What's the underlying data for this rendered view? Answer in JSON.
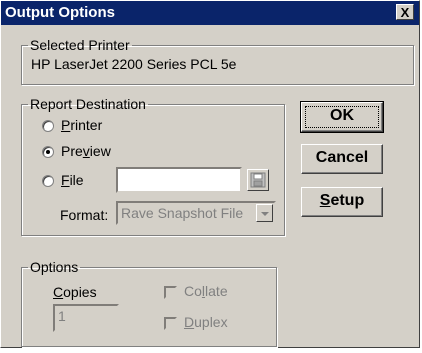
{
  "window": {
    "title": "Output Options",
    "close_symbol": "X"
  },
  "printer_group": {
    "legend": "Selected Printer",
    "printer_name": "HP LaserJet 2200 Series PCL 5e"
  },
  "destination_group": {
    "legend": "Report Destination",
    "options": [
      {
        "prefix": "",
        "accel": "P",
        "rest": "rinter",
        "selected": false
      },
      {
        "prefix": "Pre",
        "accel": "v",
        "rest": "iew",
        "selected": true
      },
      {
        "prefix": "",
        "accel": "F",
        "rest": "ile",
        "selected": false
      }
    ],
    "file_value": "",
    "format_label": "Format:",
    "format_value": "Rave Snapshot File"
  },
  "options_group": {
    "legend": "Options",
    "copies_accel": "C",
    "copies_rest": "opies",
    "copies_value": "1",
    "collate_prefix": "Co",
    "collate_accel": "l",
    "collate_rest": "late",
    "collate_checked": false,
    "duplex_accel": "D",
    "duplex_rest": "uplex",
    "duplex_checked": false
  },
  "buttons": {
    "ok": "OK",
    "cancel": "Cancel",
    "setup_accel": "S",
    "setup_rest": "etup"
  }
}
